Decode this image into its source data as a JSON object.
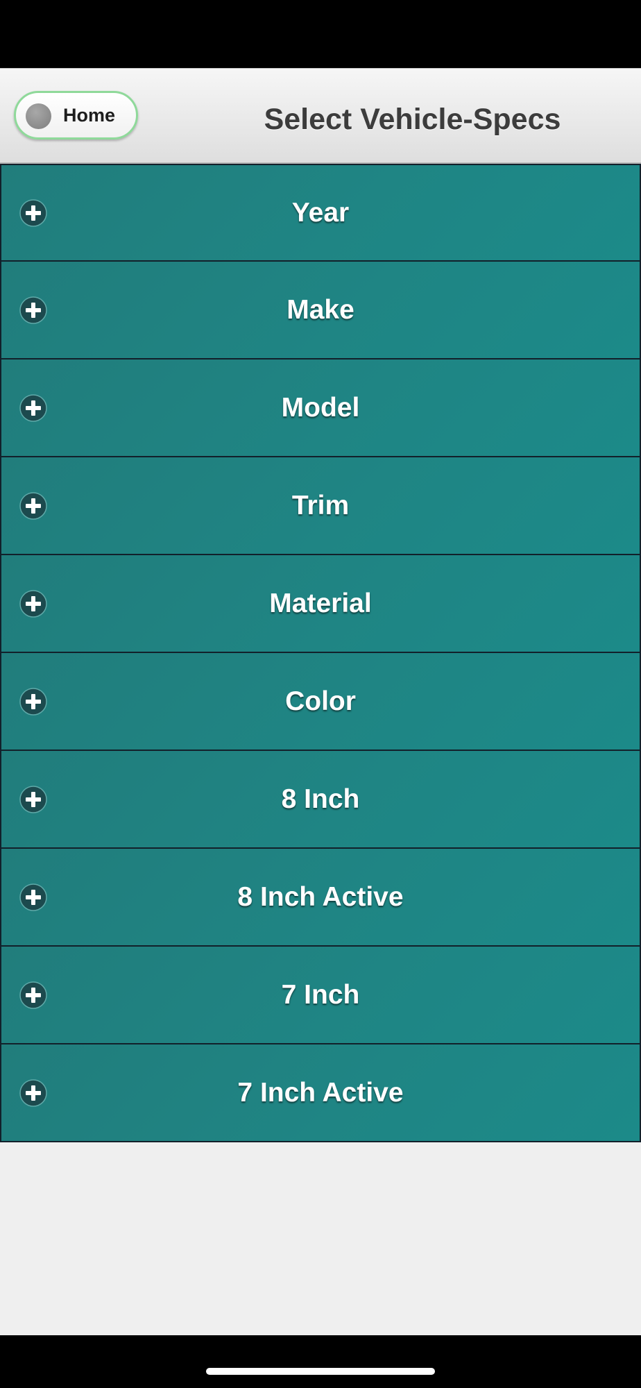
{
  "header": {
    "home_label": "Home",
    "title": "Select Vehicle-Specs"
  },
  "specs": [
    {
      "label": "Year",
      "icon": "plus-circle-icon"
    },
    {
      "label": "Make",
      "icon": "plus-circle-icon"
    },
    {
      "label": "Model",
      "icon": "plus-circle-icon"
    },
    {
      "label": "Trim",
      "icon": "plus-circle-icon"
    },
    {
      "label": "Material",
      "icon": "plus-circle-icon"
    },
    {
      "label": "Color",
      "icon": "plus-circle-icon"
    },
    {
      "label": "8 Inch",
      "icon": "plus-circle-icon"
    },
    {
      "label": "8 Inch Active",
      "icon": "plus-circle-icon"
    },
    {
      "label": "7 Inch",
      "icon": "plus-circle-icon"
    },
    {
      "label": "7 Inch Active",
      "icon": "plus-circle-icon"
    }
  ],
  "colors": {
    "row_bg": "#1f8584",
    "row_border": "#12202a",
    "row_text": "#ffffff",
    "home_border": "#8fd99a",
    "page_bg": "#efefef"
  }
}
